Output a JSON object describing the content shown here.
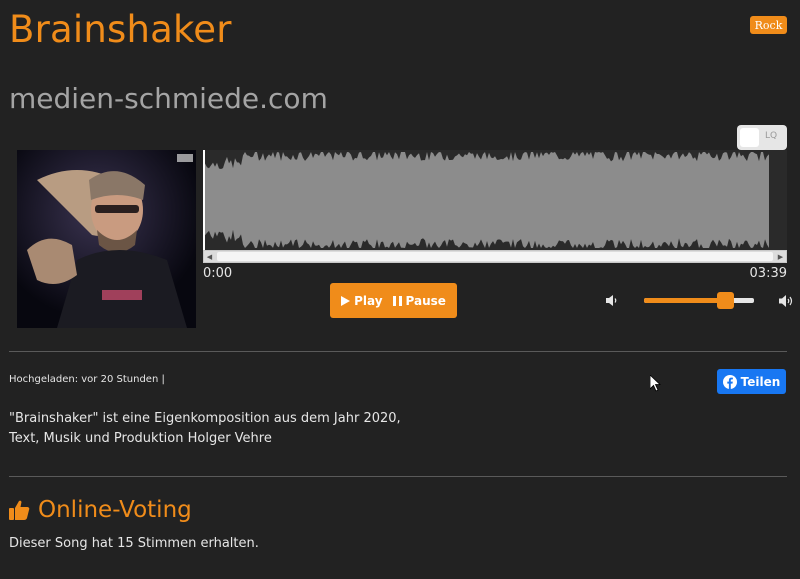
{
  "track": {
    "title": "Brainshaker",
    "genre": "Rock",
    "artist_site": "medien-schmiede.com"
  },
  "player": {
    "quality_label": "LQ",
    "time_current": "0:00",
    "time_total": "03:39",
    "play_label": "Play",
    "pause_label": "Pause",
    "volume_level": 0.75,
    "accent_color": "#f08c1a"
  },
  "meta": {
    "uploaded": "Hochgeladen: vor 20 Stunden |",
    "share_label": "Teilen"
  },
  "description": {
    "line1": "\"Brainshaker\" ist eine Eigenkomposition aus dem Jahr 2020,",
    "line2": "Text, Musik und Produktion Holger Vehre"
  },
  "voting": {
    "title": "Online-Voting",
    "text": "Dieser Song hat 15 Stimmen erhalten."
  },
  "icons": {
    "play": "play-icon",
    "pause": "pause-icon",
    "volume_low": "volume-low-icon",
    "volume_high": "volume-high-icon",
    "facebook": "facebook-icon",
    "thumbs_up": "thumbs-up-icon"
  }
}
